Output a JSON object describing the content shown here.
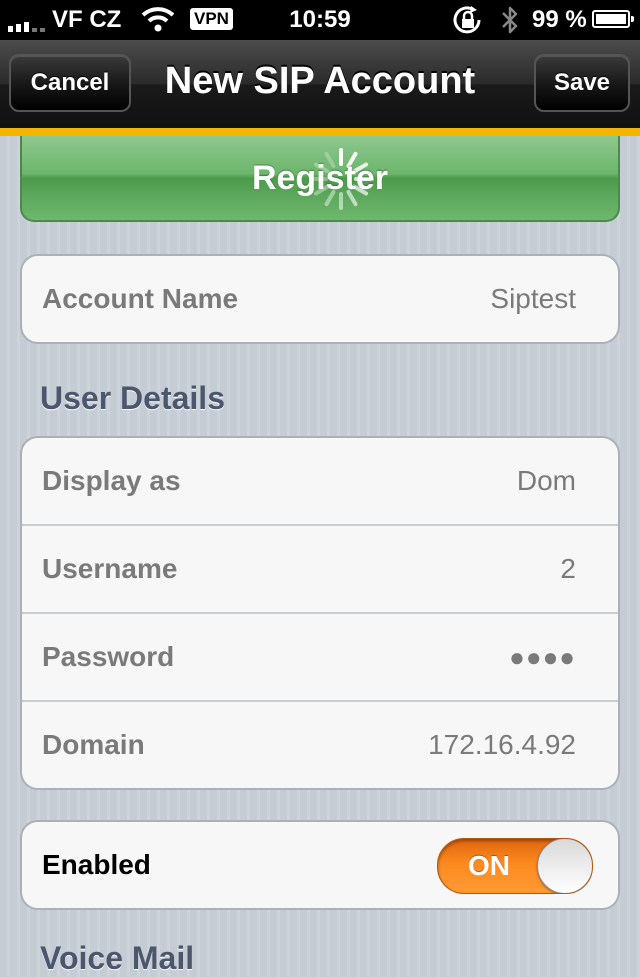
{
  "status_bar": {
    "carrier": "VF CZ",
    "vpn": "VPN",
    "time": "10:59",
    "battery_percent": "99 %",
    "battery_level": 0.99,
    "icons": [
      "signal-icon",
      "wifi-icon",
      "rotation-lock-icon",
      "bluetooth-icon",
      "battery-icon"
    ]
  },
  "nav": {
    "title": "New SIP Account",
    "cancel_label": "Cancel",
    "save_label": "Save"
  },
  "register_label": "Register",
  "account": {
    "label": "Account Name",
    "value": "Siptest"
  },
  "user_details": {
    "header": "User Details",
    "rows": [
      {
        "label": "Display as",
        "value": "Dom"
      },
      {
        "label": "Username",
        "value": "2"
      },
      {
        "label": "Password",
        "value": "●●●●"
      },
      {
        "label": "Domain",
        "value": "172.16.4.92"
      }
    ]
  },
  "enabled": {
    "label": "Enabled",
    "toggle_label": "ON",
    "is_on": true
  },
  "next_section_header": "Voice Mail",
  "colors": {
    "accent_bar": "#f4b400",
    "register_green": "#6cb56c",
    "toggle_orange": "#fc8a1e"
  }
}
